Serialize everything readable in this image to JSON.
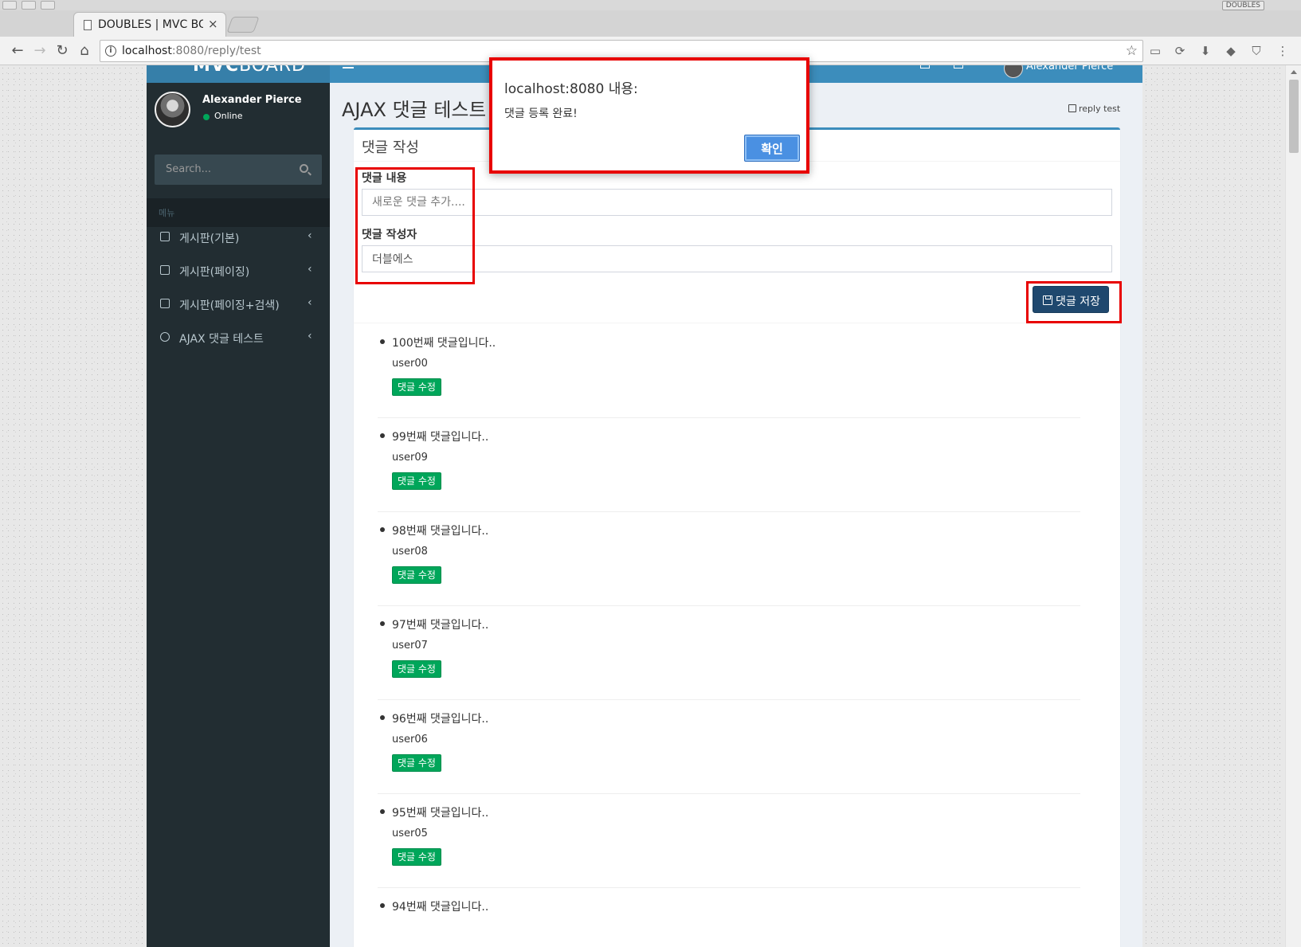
{
  "browser": {
    "tab_title": "DOUBLES | MVC BOARD",
    "url_host": "localhost",
    "url_rest": ":8080/reply/test",
    "extension_badge": "DOUBLES",
    "icons": [
      "back-arrow-icon",
      "forward-arrow-icon",
      "reload-icon",
      "home-icon",
      "info-icon",
      "star-icon",
      "extension-icon",
      "download-icon",
      "menu-dots-icon"
    ]
  },
  "app": {
    "logo_bold": "MVC",
    "logo_light": "BOARD",
    "nav_user": "Alexander Pierce"
  },
  "sidebar": {
    "user_name": "Alexander Pierce",
    "status": "Online",
    "search_placeholder": "Search...",
    "menu_header": "메뉴",
    "items": [
      {
        "label": "게시판(기본)",
        "icon": "edit-icon"
      },
      {
        "label": "게시판(페이징)",
        "icon": "edit-icon"
      },
      {
        "label": "게시판(페이징+검색)",
        "icon": "edit-icon"
      },
      {
        "label": "AJAX 댓글 테스트",
        "icon": "check-circle-icon"
      }
    ]
  },
  "content": {
    "page_title": "AJAX 댓글 테스트 페이지",
    "breadcrumb": "reply test"
  },
  "form": {
    "box_title": "댓글 작성",
    "text_label": "댓글 내용",
    "text_placeholder": "새로운 댓글 추가....",
    "text_value": "",
    "writer_label": "댓글 작성자",
    "writer_value": "더블에스",
    "save_label": "댓글 저장"
  },
  "replies": [
    {
      "text": "100번째 댓글입니다..",
      "writer": "user00",
      "button": "댓글 수정"
    },
    {
      "text": "99번째 댓글입니다..",
      "writer": "user09",
      "button": "댓글 수정"
    },
    {
      "text": "98번째 댓글입니다..",
      "writer": "user08",
      "button": "댓글 수정"
    },
    {
      "text": "97번째 댓글입니다..",
      "writer": "user07",
      "button": "댓글 수정"
    },
    {
      "text": "96번째 댓글입니다..",
      "writer": "user06",
      "button": "댓글 수정"
    },
    {
      "text": "95번째 댓글입니다..",
      "writer": "user05",
      "button": "댓글 수정"
    },
    {
      "text": "94번째 댓글입니다..",
      "writer": "",
      "button": ""
    }
  ],
  "dialog": {
    "title": "localhost:8080 내용:",
    "message": "댓글 등록 완료!",
    "ok_label": "확인"
  },
  "colors": {
    "annotation": "#e80000",
    "header_blue": "#3c8dbc",
    "sidebar_dark": "#222d32",
    "save_button": "#1f486e",
    "edit_button": "#00a65a"
  }
}
